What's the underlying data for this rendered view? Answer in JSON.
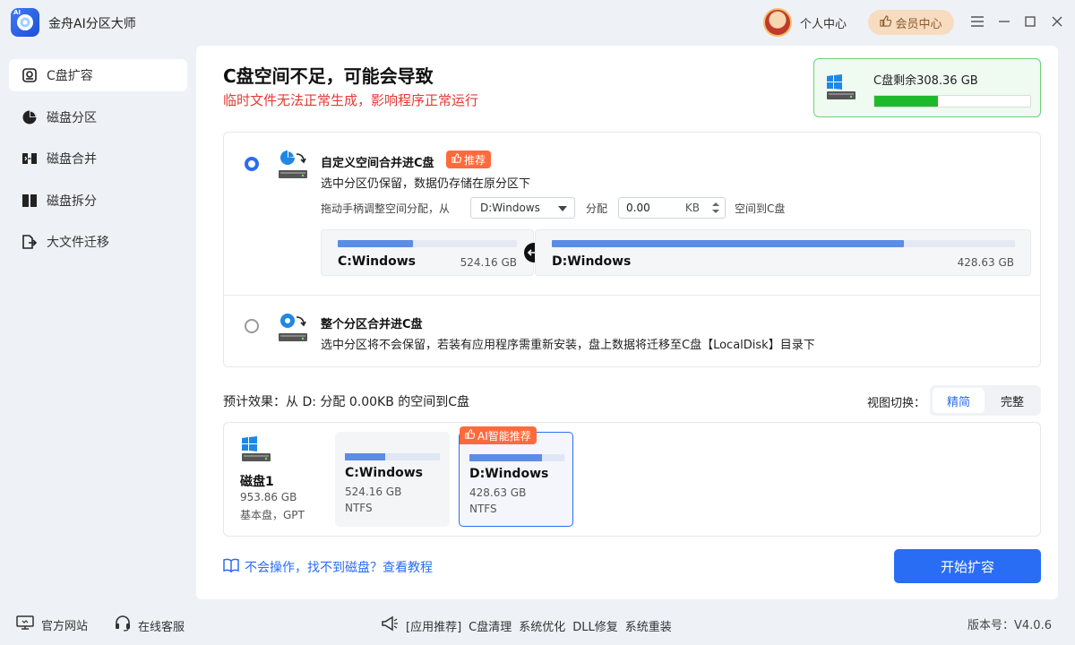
{
  "app": {
    "title": "金舟AI分区大师",
    "logo_badge": "AI",
    "user_center": "个人中心",
    "vip_label": "会员中心"
  },
  "sidebar": {
    "items": [
      {
        "label": "C盘扩容",
        "icon": "drive-icon",
        "active": true
      },
      {
        "label": "磁盘分区",
        "icon": "pie-icon",
        "active": false
      },
      {
        "label": "磁盘合并",
        "icon": "merge-icon",
        "active": false
      },
      {
        "label": "磁盘拆分",
        "icon": "split-icon",
        "active": false
      },
      {
        "label": "大文件迁移",
        "icon": "migrate-icon",
        "active": false
      }
    ]
  },
  "main": {
    "headline": "C盘空间不足，可能会导致",
    "subline": "临时文件无法正常生成，影响程序正常运行",
    "free": {
      "label": "C盘剩余308.36 GB",
      "used_fraction": 0.41
    }
  },
  "option1": {
    "title": "自定义空间合并进C盘",
    "badge": "推荐",
    "desc": "选中分区仍保留，数据仍存储在原分区下",
    "alloc_prefix": "拖动手柄调整空间分配，从",
    "from_value": "D:Windows",
    "alloc_mid": "分配",
    "amount": "0.00",
    "unit": "KB",
    "alloc_suffix": "空间到C盘",
    "partitions": [
      {
        "name": "C:Windows",
        "size": "524.16 GB",
        "used_fraction": 0.42
      },
      {
        "name": "D:Windows",
        "size": "428.63 GB",
        "used_fraction": 0.76
      }
    ]
  },
  "option2": {
    "title": "整个分区合并进C盘",
    "desc": "选中分区将不会保留，若装有应用程序需重新安装，盘上数据将迁移至C盘【LocalDisk】目录下"
  },
  "effect": {
    "text": "预计效果：从 D: 分配 0.00KB 的空间到C盘",
    "view_label": "视图切换：",
    "view_simple": "精简",
    "view_full": "完整"
  },
  "preview": {
    "disk_name": "磁盘1",
    "disk_size": "953.86 GB",
    "disk_type": "基本盘，GPT",
    "ai_badge": "AI智能推荐",
    "cards": [
      {
        "name": "C:Windows",
        "size": "524.16 GB",
        "fs": "NTFS",
        "used_fraction": 0.42
      },
      {
        "name": "D:Windows",
        "size": "428.63 GB",
        "fs": "NTFS",
        "used_fraction": 0.76
      }
    ]
  },
  "help_link": "不会操作，找不到磁盘？查看教程",
  "start_button": "开始扩容",
  "footer": {
    "website": "官方网站",
    "support": "在线客服",
    "links": [
      "[应用推荐]",
      "C盘清理",
      "系统优化",
      "DLL修复",
      "系统重装"
    ],
    "version": "版本号：V4.0.6"
  },
  "colors": {
    "accent": "#2a6df5",
    "warning": "#e53935",
    "badge": "#ff6a3d",
    "free_bar": "#1fba2c"
  }
}
